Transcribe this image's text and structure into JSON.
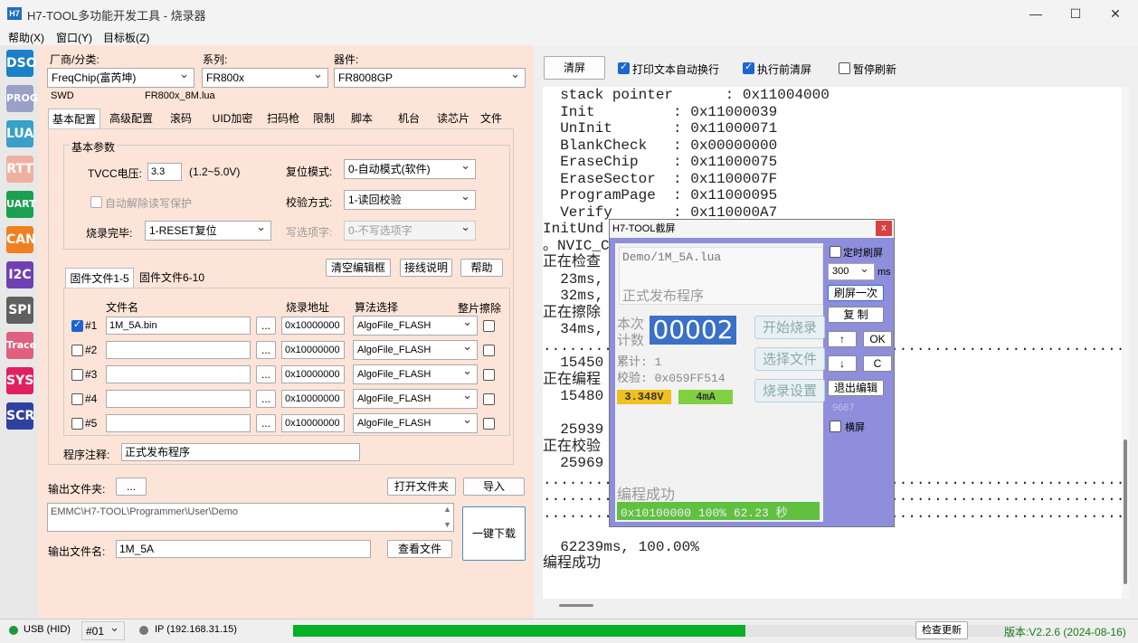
{
  "window": {
    "title": "H7-TOOL多功能开发工具 - 烧录器",
    "logo": "H7",
    "minimize": "—",
    "maximize": "☐",
    "close": "✕"
  },
  "menu": [
    "帮助(X)",
    "窗口(Y)",
    "目标板(Z)"
  ],
  "tools": [
    {
      "label": "DSO",
      "color": "#1b80c8"
    },
    {
      "label": "PROG",
      "color": "#9aa0c8"
    },
    {
      "label": "LUA",
      "color": "#39a0c8"
    },
    {
      "label": "RTT",
      "color": "#f0b0a0"
    },
    {
      "label": "UART",
      "color": "#1aa050"
    },
    {
      "label": "CAN",
      "color": "#f08020"
    },
    {
      "label": "I2C",
      "color": "#7040b0"
    },
    {
      "label": "SPI",
      "color": "#606060"
    },
    {
      "label": "Trace",
      "color": "#e06080"
    },
    {
      "label": "SYS",
      "color": "#e02060"
    },
    {
      "label": "SCR",
      "color": "#3040a0"
    }
  ],
  "vendor": {
    "label": "厂商/分类:",
    "value": "FreqChip(富芮坤)"
  },
  "series": {
    "label": "系列:",
    "value": "FR800x"
  },
  "device": {
    "label": "器件:",
    "value": "FR8008GP"
  },
  "iface": "SWD",
  "algo_file": "FR800x_8M.lua",
  "tabs": [
    "基本配置",
    "高级配置",
    "滚码",
    "UID加密",
    "扫码枪",
    "限制",
    "脚本",
    "机台",
    "读芯片",
    "文件"
  ],
  "basic": {
    "group": "基本参数",
    "tvcc_label": "TVCC电压:",
    "tvcc_value": "3.3",
    "tvcc_range": "(1.2~5.0V)",
    "reset_label": "复位模式:",
    "reset_value": "0-自动模式(软件)",
    "auto_unlock": "自动解除读写保护",
    "verify_label": "校验方式:",
    "verify_value": "1-读回校验",
    "finish_label": "烧录完毕:",
    "finish_value": "1-RESET复位",
    "option_label": "写选项字:",
    "option_value": "0-不写选项字"
  },
  "file_buttons": {
    "clear": "清空编辑框",
    "wiring": "接线说明",
    "help": "帮助"
  },
  "file_tabs": [
    "固件文件1-5",
    "固件文件6-10"
  ],
  "file_headers": {
    "name": "文件名",
    "addr": "烧录地址",
    "algo": "算法选择",
    "erase": "整片擦除"
  },
  "files": [
    {
      "id": "#1",
      "checked": true,
      "name": "1M_5A.bin",
      "addr": "0x10000000",
      "algo": "AlgoFile_FLASH"
    },
    {
      "id": "#2",
      "checked": false,
      "name": "",
      "addr": "0x10000000",
      "algo": "AlgoFile_FLASH"
    },
    {
      "id": "#3",
      "checked": false,
      "name": "",
      "addr": "0x10000000",
      "algo": "AlgoFile_FLASH"
    },
    {
      "id": "#4",
      "checked": false,
      "name": "",
      "addr": "0x10000000",
      "algo": "AlgoFile_FLASH"
    },
    {
      "id": "#5",
      "checked": false,
      "name": "",
      "addr": "0x10000000",
      "algo": "AlgoFile_FLASH"
    }
  ],
  "browse": "...",
  "note": {
    "label": "程序注释:",
    "value": "正式发布程序"
  },
  "output": {
    "folder_label": "输出文件夹:",
    "browse": "...",
    "open_folder": "打开文件夹",
    "import": "导入",
    "path": "EMMC\\H7-TOOL\\Programmer\\User\\Demo",
    "name_label": "输出文件名:",
    "name_value": "1M_5A",
    "view_file": "查看文件",
    "download": "一键下载"
  },
  "console": {
    "clear": "清屏",
    "wrap": "打印文本自动换行",
    "clear_before": "执行前清屏",
    "pause": "暂停刷新",
    "lines": [
      "  stack pointer      : 0x11004000",
      "  Init         : 0x11000039",
      "  UnInit       : 0x11000071",
      "  BlankCheck   : 0x00000000",
      "  EraseChip    : 0x11000075",
      "  EraseSector  : 0x1100007F",
      "  ProgramPage  : 0x11000095",
      "  Verify       : 0x110000A7",
      "InitUnd",
      "。NVIC_Cl",
      "正在检查",
      "  23ms,",
      "  32ms,",
      "正在擦除",
      "  34ms,",
      "....................................................................",
      "  15450",
      "正在编程",
      "  15480",
      "",
      "  25939",
      "正在校验",
      "  25969",
      "....................................................................",
      "....................................................................",
      "....................................................................",
      "",
      "  62239ms, 100.00%",
      "编程成功"
    ]
  },
  "dialog": {
    "title": "H7-TOOL截屏",
    "close": "x",
    "file": "Demo/1M_5A.lua",
    "note": "正式发布程序",
    "count_label_1": "本次",
    "count_label_2": "计数",
    "count": "00002",
    "start": "开始烧录",
    "select": "选择文件",
    "settings": "烧录设置",
    "total": "累计: 1",
    "checksum": "校验: 0x059FF514",
    "voltage": "3.348V",
    "current": "4mA",
    "status": "编程成功",
    "progress_text": "0x10100000  100%  62.23 秒",
    "progress": 1.0,
    "timed_refresh": "定时刷屏",
    "interval": "300",
    "ms": "ms",
    "refresh_once": "刷屏一次",
    "copy": "复 制",
    "up": "↑",
    "ok": "OK",
    "down": "↓",
    "c": "C",
    "exit_edit": "退出编辑",
    "number": "9667",
    "landscape": "横屏"
  },
  "status": {
    "usb": "USB (HID)",
    "port": "#01",
    "ip": "IP (192.168.31.15)",
    "progress": 0.62,
    "check_update": "检查更新",
    "version": "版本:V2.2.6 (2024-08-16)"
  }
}
